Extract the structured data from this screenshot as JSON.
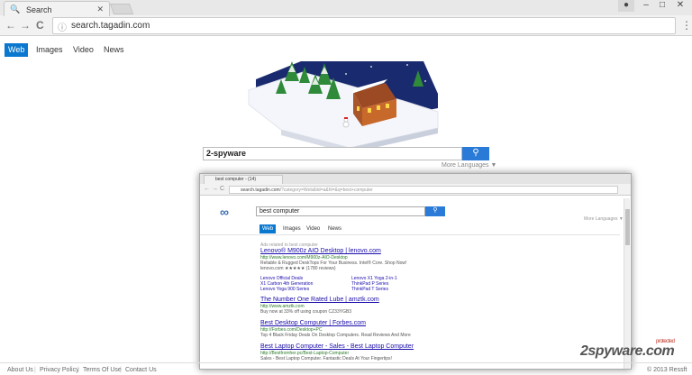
{
  "browser": {
    "tab_title": "Search",
    "address": "search.tagadin.com",
    "nav": {
      "back": "←",
      "forward": "→",
      "reload": "C"
    }
  },
  "verticals": [
    "Web",
    "Images",
    "Video",
    "News"
  ],
  "search": {
    "query": "2-spyware",
    "button_icon": "search-icon",
    "more_languages": "More Languages ▼"
  },
  "footer": {
    "about": "About Us",
    "privacy": "Privacy Policy",
    "terms": "Terms Of Use",
    "contact": "Contact Us",
    "copyright": "© 2013 Ressft"
  },
  "inner": {
    "tab_title": "best computer - (14)",
    "address_host": "search.tagadin.com",
    "address_rest": "/?category=Web&tid=a&hl=&q=best+computer",
    "query": "best computer",
    "more_languages": "More Languages ▼",
    "verticals": [
      "Web",
      "Images",
      "Video",
      "News"
    ],
    "ads_label": "Ads related to best computer",
    "results": [
      {
        "title": "Lenovo® M900z AIO Desktop | lenovo.com",
        "url": "http://www.lenovo.com/M900z-AIO-Desktop",
        "snippet": "Reliable & Rugged DeskTops For Your Business. Intel® Core. Shop Now!",
        "extra": "lenovo.com ★★★★★ (1780 reviews)"
      },
      {
        "title": "The Number One Rated Lube | amztk.com",
        "url": "http://www.amztk.com",
        "snippet": "Buy now at 33% off using coupon CZ33YGB3"
      },
      {
        "title": "Best Desktop Computer | Forbes.com",
        "url": "http://Forbes.com/Desktop+PC",
        "snippet": "Top 4 Black Friday Deals On Desktop Computers. Read Reviews And More"
      },
      {
        "title": "Best Laptop Computer - Sales - Best Laptop Computer",
        "url": "http://Bestfromher.pc/Best-Laptop-Computer",
        "snippet": "Sales - Best Laptop Computer. Fantastic Deals At Your Fingertips!"
      }
    ],
    "sitelinks": [
      "Lenovo Official Deals",
      "X1 Carbon 4th Generation",
      "Lenovo Yoga 900 Series",
      "Lenovo X1 Yoga 2-in-1",
      "ThinkPad P Series",
      "ThinkPad T Series"
    ]
  },
  "watermark": {
    "brand": "2spyware.com",
    "tag": "protected"
  },
  "colors": {
    "accent": "#0b78cf",
    "button": "#2a7bd7",
    "sky": "#1a2a6e",
    "snow": "#f4f6fb"
  }
}
